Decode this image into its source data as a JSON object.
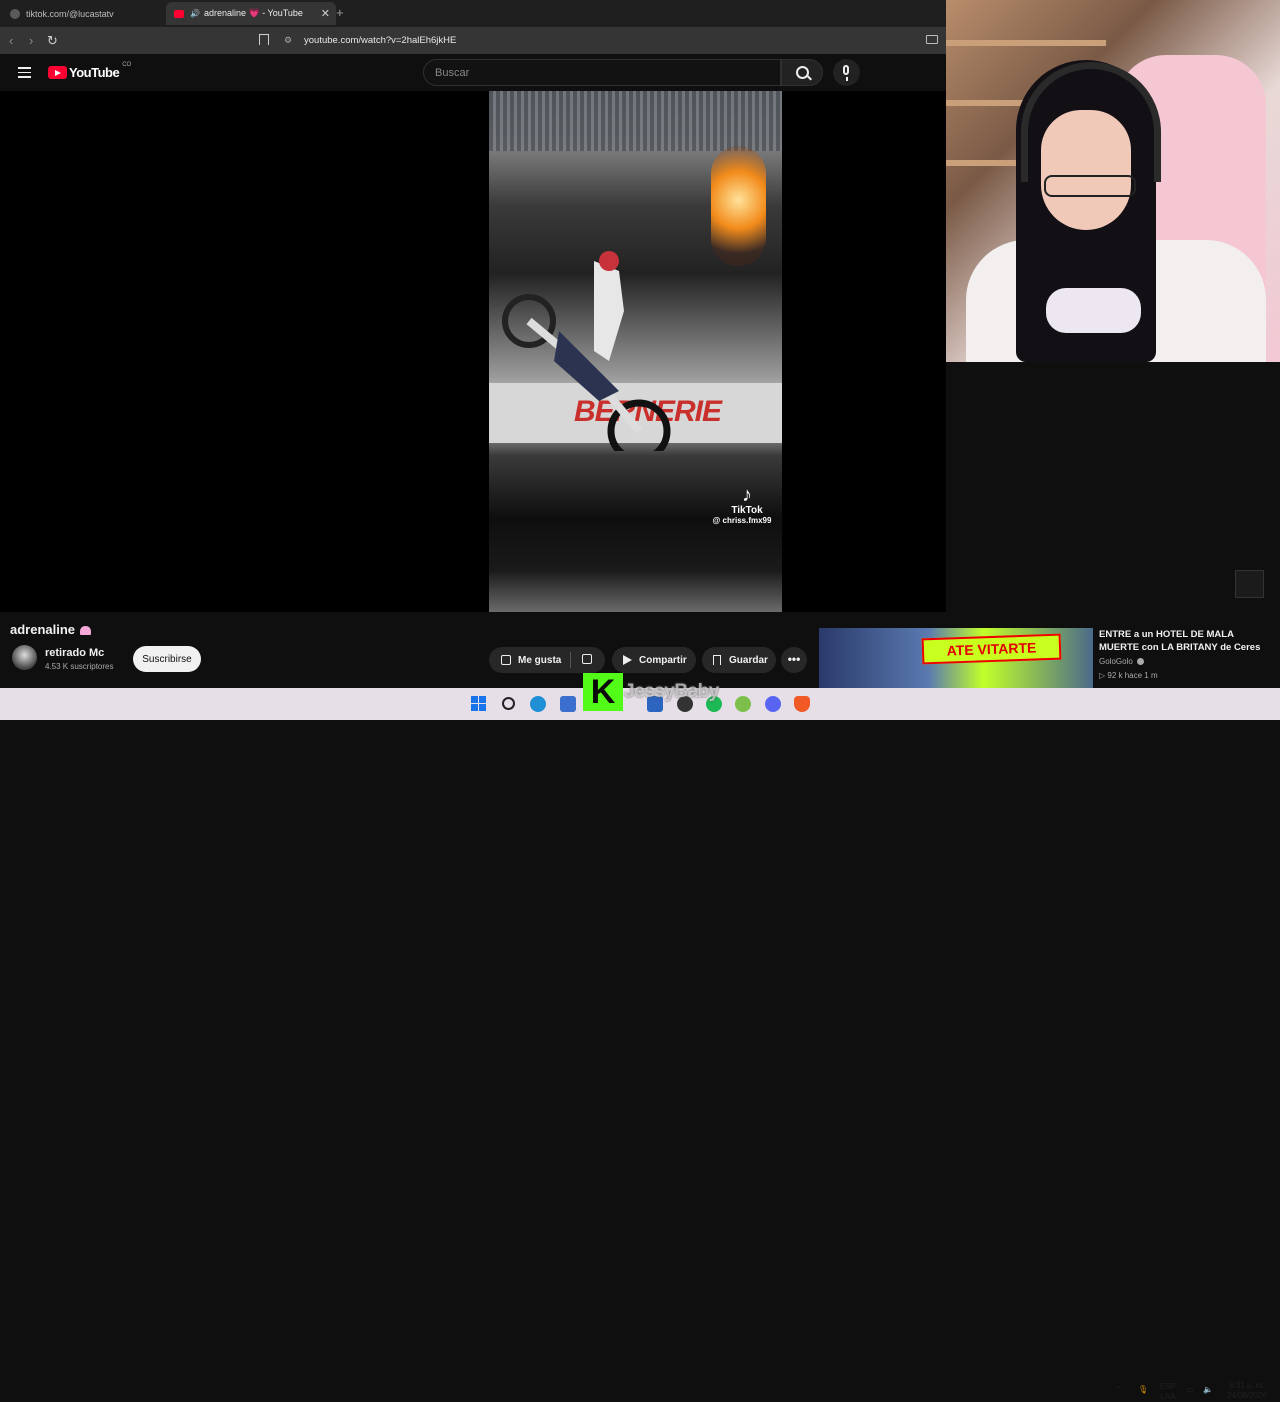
{
  "browser": {
    "tabs": [
      {
        "label": "tiktok.com/@lucastatv",
        "active": false
      },
      {
        "label": "adrenaline 💗 - YouTube",
        "active": true,
        "audio": "🔊"
      }
    ],
    "new_tab": "+",
    "close": "✕",
    "url": "youtube.com/watch?v=2halEh6jkHE",
    "back": "‹",
    "forward": "›",
    "reload": "↻"
  },
  "youtube": {
    "logo_text": "YouTube",
    "country_code": "CO",
    "search_placeholder": "Buscar"
  },
  "video": {
    "watermark_brand": "TikTok",
    "watermark_handle": "@ chriss.fmx99",
    "banner_text": "BERNERIE"
  },
  "info": {
    "title": "adrenaline",
    "channel": "retirado Mc",
    "subscribers": "4.53 K suscriptores",
    "subscribe_label": "Suscribirse",
    "like_label": "Me gusta",
    "share_label": "Compartir",
    "save_label": "Guardar",
    "more_label": "•••"
  },
  "related": {
    "title": "ENTRE a un HOTEL DE MALA MUERTE con LA BRITANY de Ceres",
    "channel": "GoloGolo",
    "meta": "▷ 92 k   hace 1 m",
    "thumb_text": "ATE VITARTE"
  },
  "overlay": {
    "k_letter": "K",
    "streamer": "JessyBaby"
  },
  "taskbar": {
    "lang_top": "ESP",
    "lang_bottom": "LAA",
    "time": "6:31 p. m.",
    "date": "24/08/2026"
  },
  "colors": {
    "youtube_red": "#ff0033",
    "kick_green": "#53fc18",
    "page_bg": "#0f0f0f"
  }
}
